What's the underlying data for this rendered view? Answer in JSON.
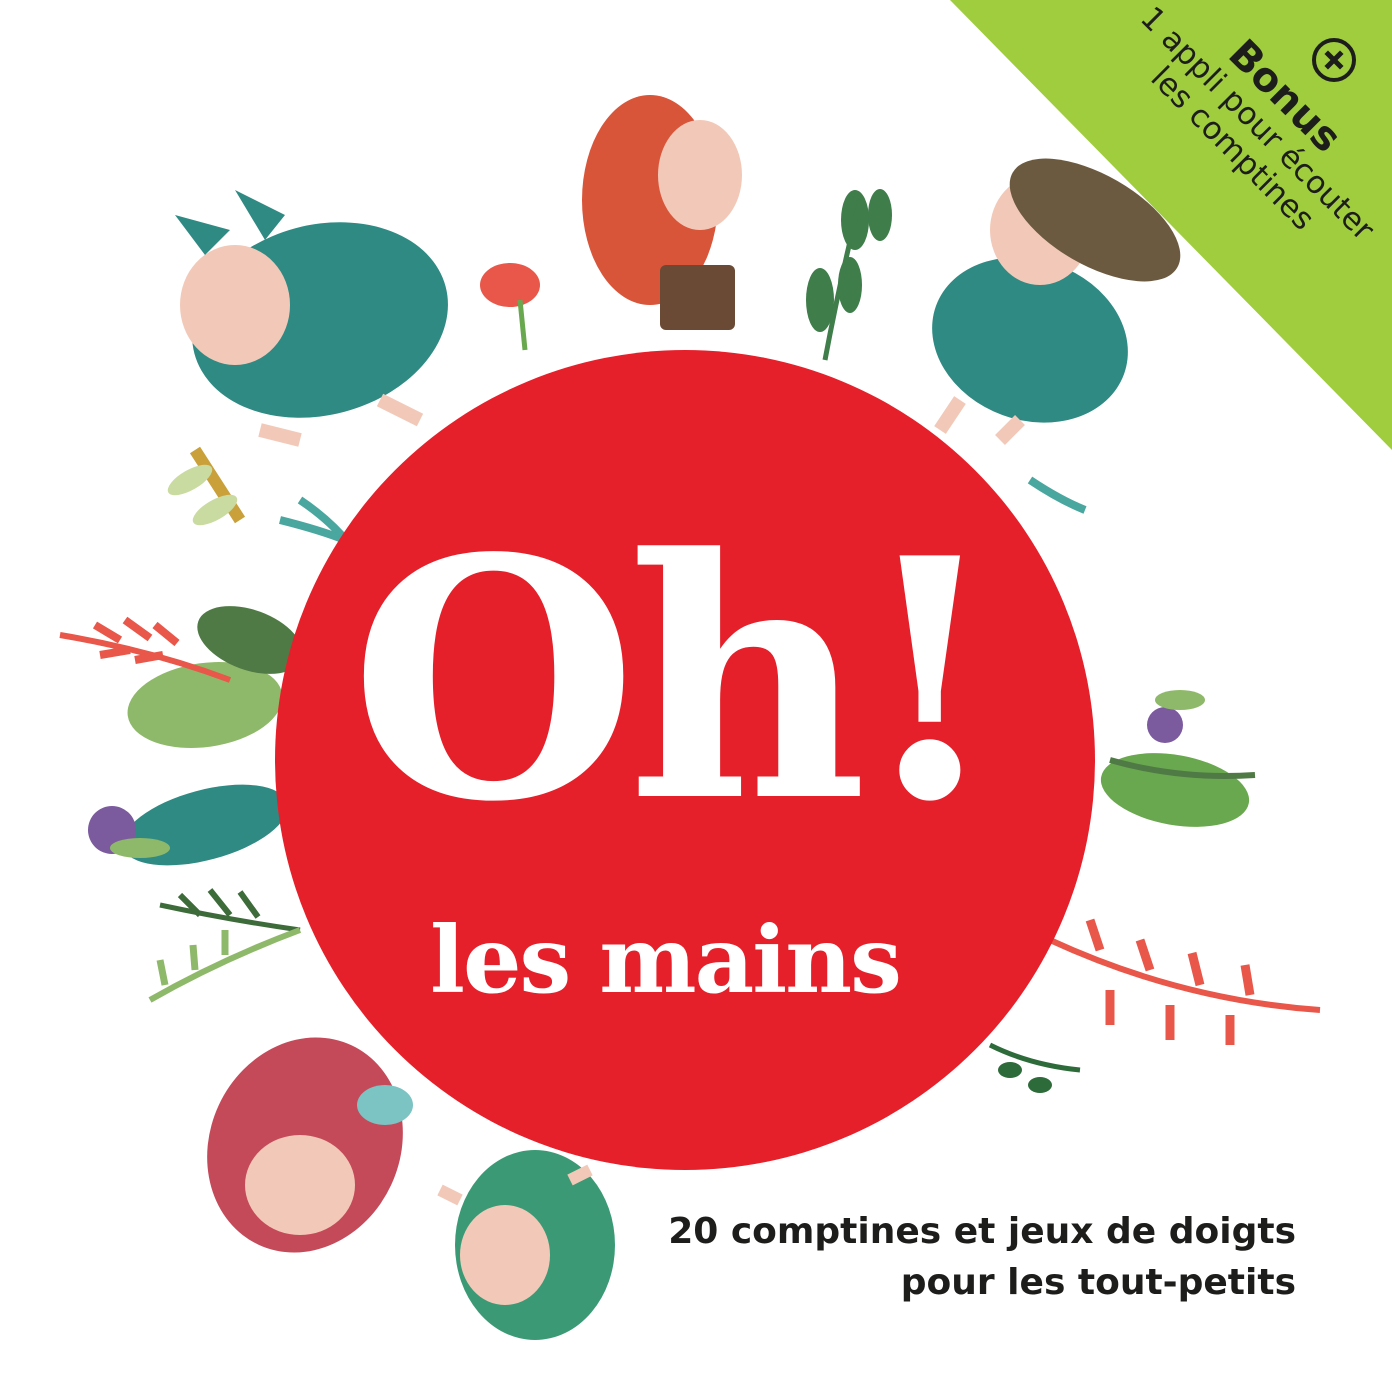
{
  "cover": {
    "title_main": "Oh!",
    "title_sub": "les mains",
    "subtitle_line1": "20 comptines et jeux de doigts",
    "subtitle_line2": "pour les tout-petits"
  },
  "bonus": {
    "icon": "plus-circle-icon",
    "title": "Bonus",
    "line1": "1 appli pour écouter",
    "line2": "les comptines"
  },
  "colors": {
    "disc": "#e5202a",
    "ribbon": "#9fcd3d",
    "text_dark": "#1d1d1b",
    "character_teal": "#2f8a83",
    "character_orange": "#d9553a",
    "character_red": "#c44a5a",
    "leaf_green": "#6aa84f",
    "leaf_red": "#e8574a"
  }
}
